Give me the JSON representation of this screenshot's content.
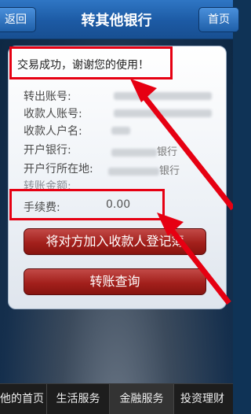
{
  "header": {
    "back_label": "返回",
    "title": "转其他银行",
    "home_label": "首页"
  },
  "result": {
    "message": "交易成功，谢谢您的使用！"
  },
  "details": {
    "rows": [
      {
        "label": "转出账号:",
        "value_text": ""
      },
      {
        "label": "收款人账号:",
        "value_text": ""
      },
      {
        "label": "收款人户名:",
        "value_text": ""
      },
      {
        "label": "开户银行:",
        "value_text": "银行"
      },
      {
        "label": "开户行所在地:",
        "value_text": "银行"
      },
      {
        "label": "转账金额:",
        "value_text": ""
      },
      {
        "label": "手续费:",
        "value_text": "0.00"
      }
    ]
  },
  "actions": {
    "add_payee": "将对方加入收款人登记簿",
    "transfer_query": "转账查询"
  },
  "bottom_nav": {
    "items": [
      "他的首页",
      "生活服务",
      "金融服务",
      "投资理财"
    ],
    "active": "金融服务"
  },
  "colors": {
    "header_blue": "#1c5aa4",
    "button_red": "#a3201c",
    "highlight_red": "#e60012"
  }
}
